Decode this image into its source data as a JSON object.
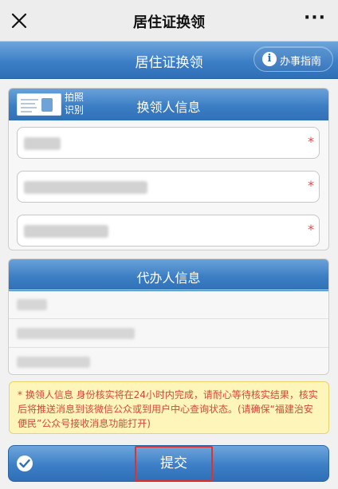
{
  "topbar": {
    "title": "居住证换领",
    "close_icon": "close-icon",
    "more_label": "···"
  },
  "header": {
    "page_title": "居住证换领",
    "guide_label": "办事指南",
    "guide_icon": "info-icon",
    "guide_icon_glyph": "i"
  },
  "applicant": {
    "title": "换领人信息",
    "ocr_label": "拍照识别",
    "ocr_icon": "id-card-icon",
    "fields": [
      {
        "value": "",
        "required_mark": "*"
      },
      {
        "value": "",
        "required_mark": "*"
      },
      {
        "value": "",
        "required_mark": "*"
      }
    ]
  },
  "agent": {
    "title": "代办人信息",
    "rows": [
      {
        "value": ""
      },
      {
        "value": ""
      },
      {
        "value": ""
      }
    ]
  },
  "notice": {
    "text": "* 换领人信息 身份核实将在24小时内完成，请耐心等待核实结果，核实后将推送消息到该微信公众或到用户中心查询状态。(请确保“福建治安便民”公众号接收消息功能打开)"
  },
  "submit": {
    "label": "提交",
    "icon": "check-circle-icon"
  },
  "colors": {
    "brand_blue": "#3d7fc6",
    "required_red": "#e0494b",
    "notice_bg": "#fdf5b9",
    "notice_text": "#d24a3a",
    "highlight_border": "#e4302b"
  }
}
